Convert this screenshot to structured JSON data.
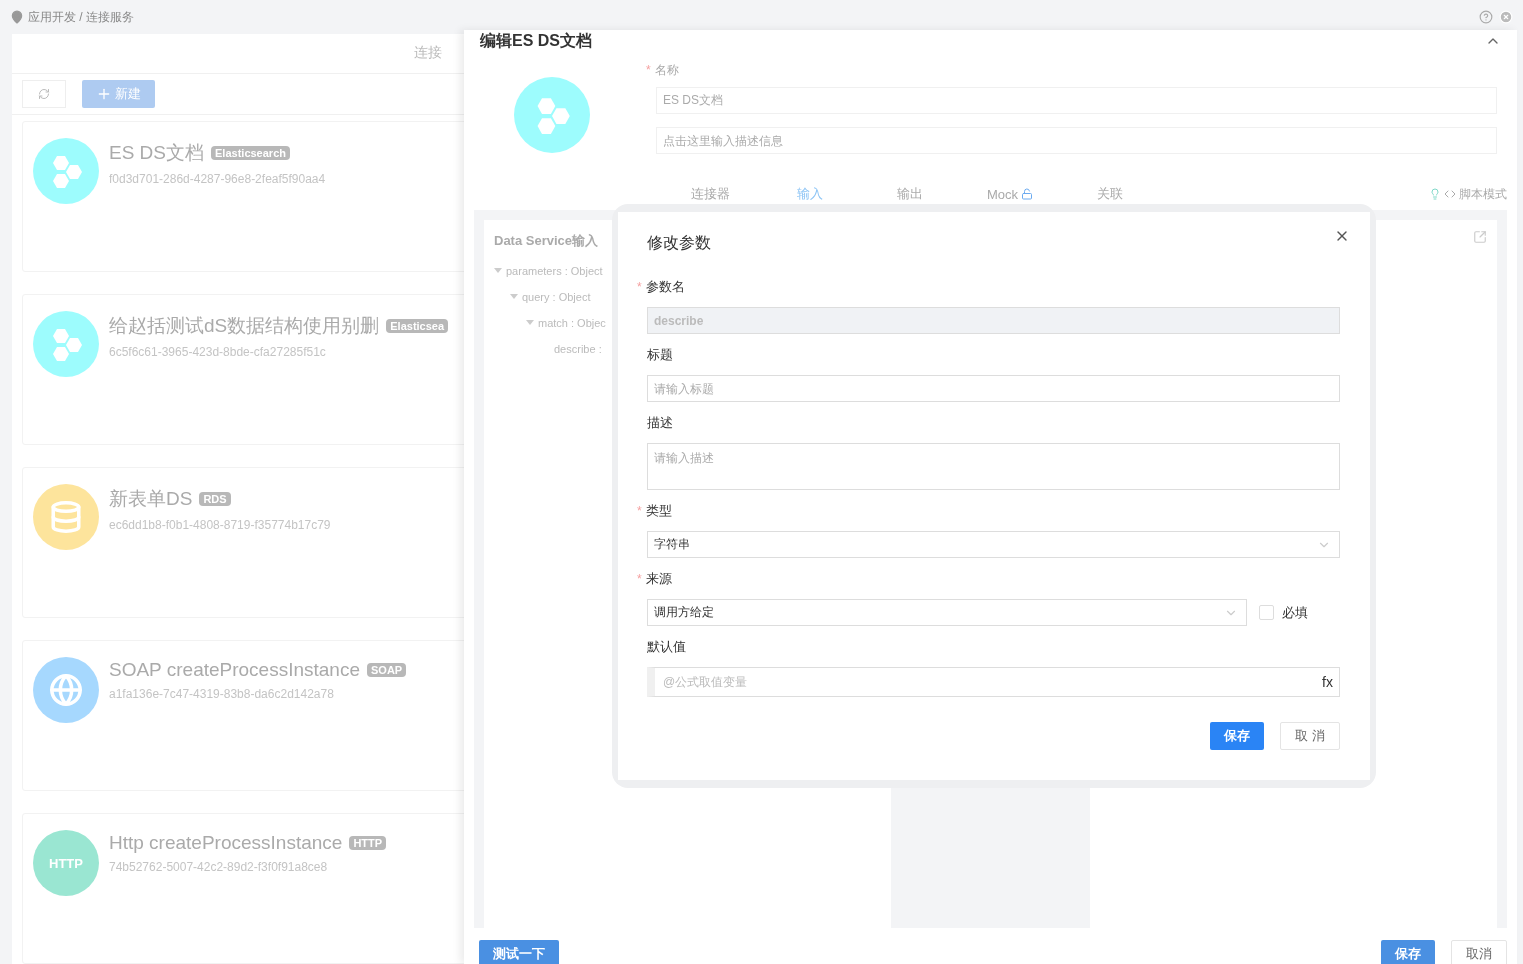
{
  "required_mark": "*",
  "breadcrumb": {
    "items": [
      "应用开发",
      "连接服务"
    ],
    "separator": "/"
  },
  "left_panel": {
    "title": "连接",
    "new_button": "新建",
    "cards": [
      {
        "kind": "elasticsearch",
        "name": "ES DS文档",
        "type": "Elasticsearch",
        "id": "f0d3d701-286d-4287-96e8-2feaf5f90aa4"
      },
      {
        "kind": "elasticsearch",
        "name": "给赵括测试dS数据结构使用别删",
        "type": "Elasticsea",
        "id": "6c5f6c61-3965-423d-8bde-cfa27285f51c"
      },
      {
        "kind": "rds",
        "name": "新表单DS",
        "type": "RDS",
        "id": "ec6dd1b8-f0b1-4808-8719-f35774b17c79"
      },
      {
        "kind": "soap",
        "name": "SOAP createProcessInstance",
        "type": "SOAP",
        "id": "a1fa136e-7c47-4319-83b8-da6c2d142a78"
      },
      {
        "kind": "http",
        "name": "Http createProcessInstance",
        "type": "HTTP",
        "id": "74b52762-5007-42c2-89d2-f3f0f91a8ce8",
        "icon_text": "HTTP"
      }
    ]
  },
  "drawer": {
    "title": "编辑ES DS文档",
    "name_label": "名称",
    "name_required": true,
    "name_value": "ES DS文档",
    "description_placeholder": "点击这里输入描述信息",
    "tabs": [
      {
        "label": "连接器",
        "selected": false,
        "locked": false
      },
      {
        "label": "输入",
        "selected": true,
        "locked": false
      },
      {
        "label": "输出",
        "selected": false,
        "locked": false
      },
      {
        "label": "Mock",
        "selected": false,
        "locked": true
      },
      {
        "label": "关联",
        "selected": false,
        "locked": false
      }
    ],
    "script_mode": "脚本模式",
    "input_panel": {
      "title": "Data Service输入",
      "tree": [
        {
          "label": "parameters : Object",
          "expanded": true,
          "children": [
            {
              "label": "query : Object",
              "expanded": true,
              "children": [
                {
                  "label": "match : Objec",
                  "expanded": true,
                  "children": [
                    {
                      "label": "describe :"
                    }
                  ]
                }
              ]
            }
          ]
        }
      ]
    },
    "footer": {
      "test_button": "测试一下",
      "save_button": "保存",
      "cancel_button": "取消"
    }
  },
  "modal": {
    "title": "修改参数",
    "fields": [
      {
        "kind": "text",
        "label": "参数名",
        "required": true,
        "disabled": true,
        "value": "describe"
      },
      {
        "kind": "text",
        "label": "标题",
        "required": false,
        "disabled": false,
        "placeholder": "请输入标题"
      },
      {
        "kind": "textarea",
        "label": "描述",
        "required": false,
        "disabled": false,
        "placeholder": "请输入描述"
      },
      {
        "kind": "select",
        "label": "类型",
        "required": true,
        "disabled": false,
        "value": "字符串"
      },
      {
        "kind": "select",
        "label": "来源",
        "required": true,
        "disabled": false,
        "value": "调用方给定",
        "checkbox": {
          "label": "必填",
          "checked": false
        }
      },
      {
        "kind": "formula",
        "label": "默认值",
        "required": false,
        "disabled": false,
        "placeholder": "@公式取值变量",
        "suffix": "fx"
      }
    ],
    "save_button": "保存",
    "cancel_button": "取 消"
  }
}
